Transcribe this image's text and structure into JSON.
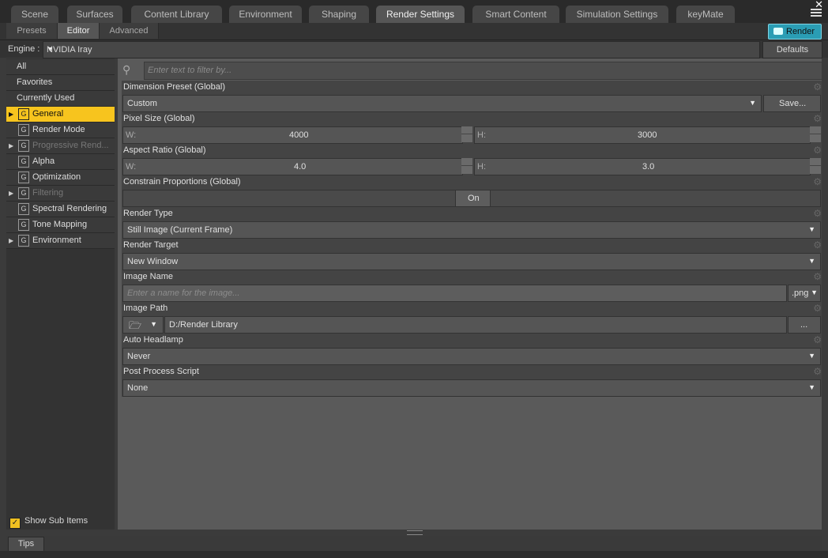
{
  "top_tabs": [
    "Scene",
    "Surfaces",
    "Content Library",
    "Environment",
    "Shaping",
    "Render Settings",
    "Smart Content",
    "Simulation Settings",
    "keyMate"
  ],
  "active_top_tab": "Render Settings",
  "sub_tabs": [
    "Presets",
    "Editor",
    "Advanced"
  ],
  "active_sub_tab": "Editor",
  "render_button": "Render",
  "engine": {
    "label": "Engine :",
    "value": "NVIDIA Iray",
    "defaults": "Defaults"
  },
  "nav": {
    "items": [
      {
        "label": "All"
      },
      {
        "label": "Favorites"
      },
      {
        "label": "Currently Used"
      },
      {
        "label": "General"
      },
      {
        "label": "Render Mode"
      },
      {
        "label": "Progressive Rend..."
      },
      {
        "label": "Alpha"
      },
      {
        "label": "Optimization"
      },
      {
        "label": "Filtering"
      },
      {
        "label": "Spectral Rendering"
      },
      {
        "label": "Tone Mapping"
      },
      {
        "label": "Environment"
      }
    ],
    "group_letter": "G",
    "show_sub_items": "Show Sub Items"
  },
  "filter": {
    "placeholder": "Enter text to filter by..."
  },
  "props": {
    "dimension_preset": {
      "title": "Dimension Preset (Global)",
      "value": "Custom",
      "save": "Save..."
    },
    "pixel_size": {
      "title": "Pixel Size (Global)",
      "w_label": "W:",
      "w": "4000",
      "h_label": "H:",
      "h": "3000"
    },
    "aspect_ratio": {
      "title": "Aspect Ratio (Global)",
      "w_label": "W:",
      "w": "4.0",
      "h_label": "H:",
      "h": "3.0"
    },
    "constrain": {
      "title": "Constrain Proportions (Global)",
      "value": "On"
    },
    "render_type": {
      "title": "Render Type",
      "value": "Still Image (Current Frame)"
    },
    "render_target": {
      "title": "Render Target",
      "value": "New Window"
    },
    "image_name": {
      "title": "Image Name",
      "placeholder": "Enter a name for the image...",
      "ext": ".png"
    },
    "image_path": {
      "title": "Image Path",
      "value": "D:/Render Library",
      "browse": "..."
    },
    "auto_headlamp": {
      "title": "Auto Headlamp",
      "value": "Never"
    },
    "post_script": {
      "title": "Post Process Script",
      "value": "None"
    }
  },
  "tips": "Tips",
  "colors": {
    "accent": "#f7c41e",
    "render": "#2a9db4"
  }
}
